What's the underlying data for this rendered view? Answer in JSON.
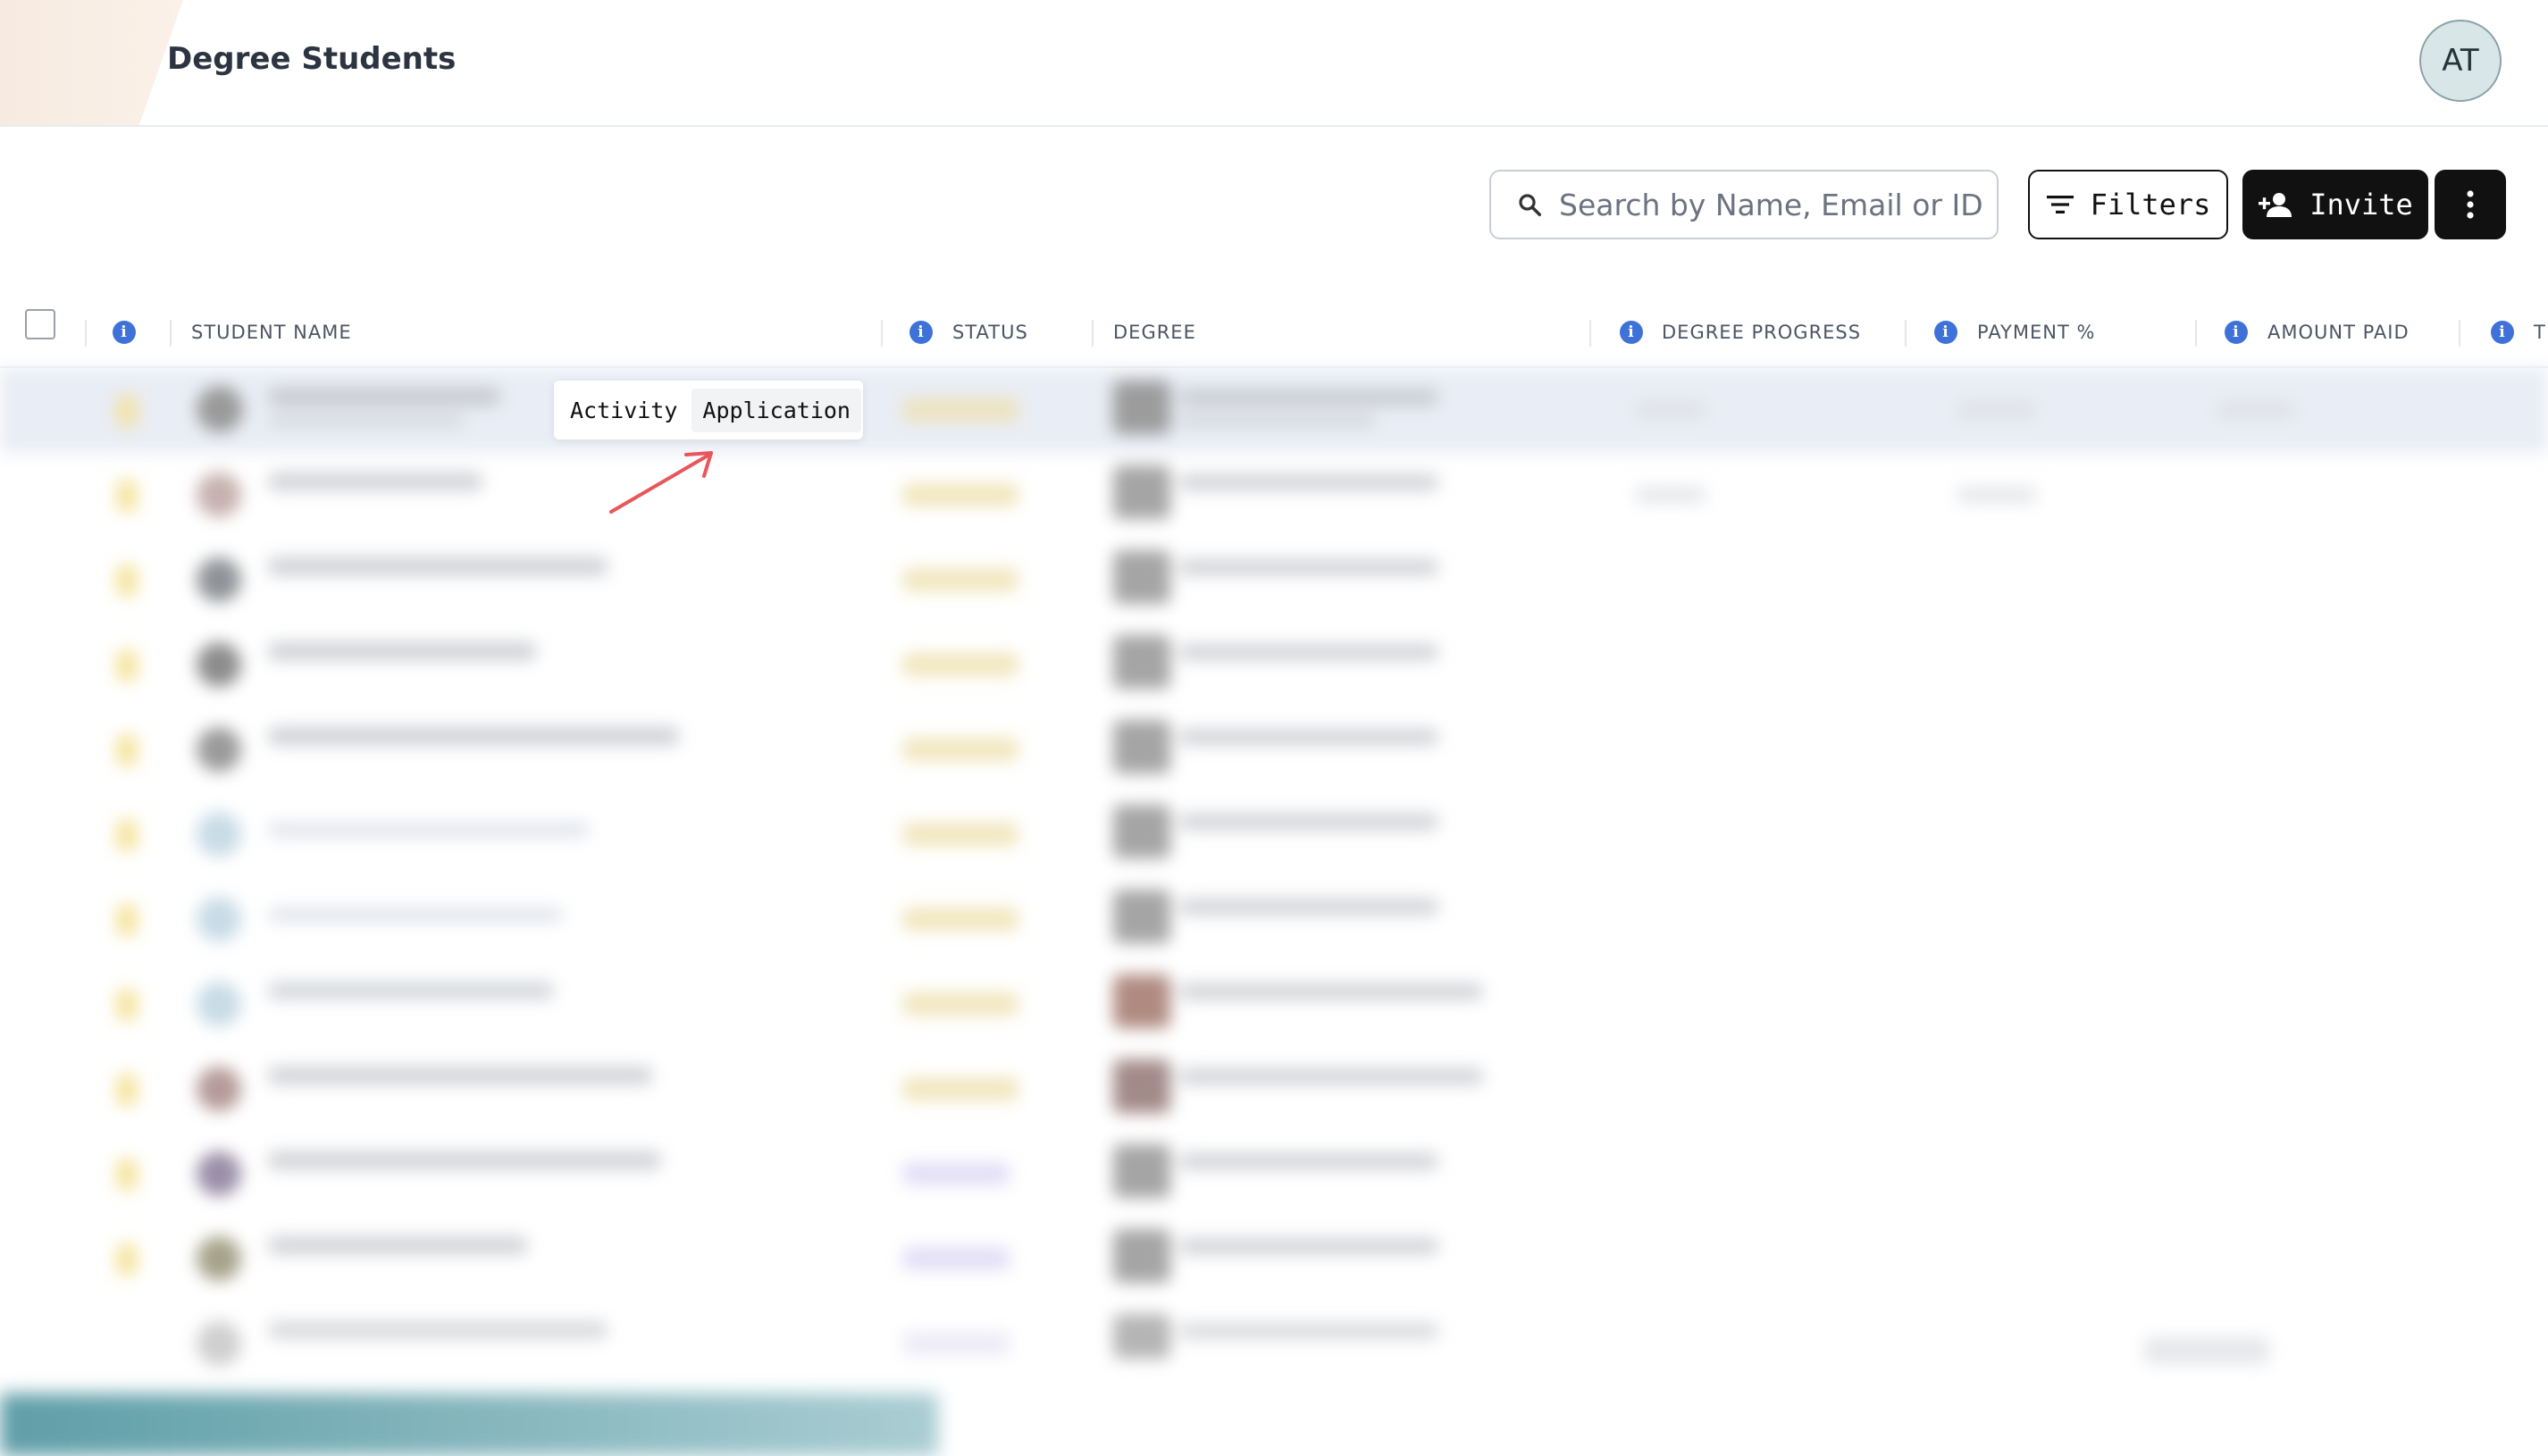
{
  "header": {
    "title": "Degree Students",
    "avatar_initials": "AT"
  },
  "toolbar": {
    "search_placeholder": "Search by Name, Email or ID",
    "filters_label": "Filters",
    "invite_label": "Invite"
  },
  "table": {
    "columns": [
      "STUDENT NAME",
      "STATUS",
      "DEGREE",
      "DEGREE PROGRESS",
      "PAYMENT %",
      "AMOUNT PAID",
      "T"
    ],
    "info_glyph": "i"
  },
  "popover": {
    "options": [
      "Activity",
      "Application"
    ]
  },
  "colors": {
    "accent_blue": "#3f72d8",
    "button_dark": "#111111",
    "arrow_red": "#e8555a"
  }
}
